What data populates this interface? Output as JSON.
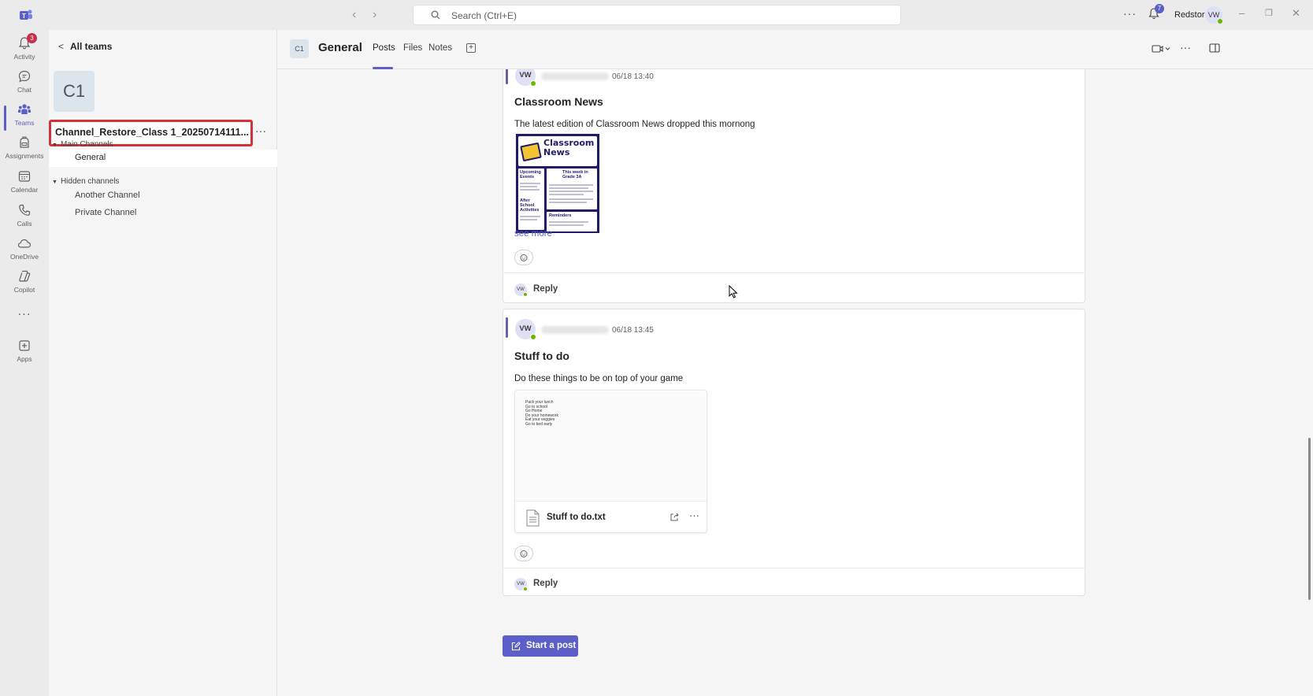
{
  "titlebar": {
    "search_placeholder": "Search (Ctrl+E)",
    "more": "···",
    "bell_badge": "7",
    "org_name": "Redstor",
    "user_initials": "VW",
    "minimize": "–",
    "restore": "❐",
    "close": "✕"
  },
  "rail": {
    "items": [
      {
        "label": "Activity",
        "icon": "bell-icon",
        "badge": "3"
      },
      {
        "label": "Chat",
        "icon": "chat-icon"
      },
      {
        "label": "Teams",
        "icon": "teams-icon"
      },
      {
        "label": "Assignments",
        "icon": "backpack-icon"
      },
      {
        "label": "Calendar",
        "icon": "calendar-icon"
      },
      {
        "label": "Calls",
        "icon": "phone-icon"
      },
      {
        "label": "OneDrive",
        "icon": "cloud-icon"
      },
      {
        "label": "Copilot",
        "icon": "copilot-icon"
      },
      {
        "label": "Apps",
        "icon": "add-app-icon"
      }
    ],
    "more": "···"
  },
  "teampanel": {
    "back_label": "All teams",
    "team_initials": "C1",
    "team_name": "Channel_Restore_Class 1_20250714111...",
    "team_more": "···",
    "sections": [
      {
        "title": "Main Channels",
        "channels": [
          "General"
        ]
      },
      {
        "title": "Hidden channels",
        "channels": [
          "Another Channel",
          "Private Channel"
        ]
      }
    ]
  },
  "channel": {
    "icon_text": "C1",
    "title": "General",
    "tabs": [
      "Posts",
      "Files",
      "Notes"
    ],
    "active_tab": "Posts",
    "add_tab": "+"
  },
  "posts": [
    {
      "initials": "VW",
      "timestamp": "06/18 13:40",
      "subject": "Classroom News",
      "body": "The latest edition of Classroom News dropped this mornong",
      "attachment": {
        "title": "Classroom News",
        "sections": [
          "Upcoming Events",
          "This week in Grade 3A",
          "After School Activities",
          "Reminders"
        ]
      },
      "see_more": "see more",
      "reply_initials": "VW",
      "reply_label": "Reply"
    },
    {
      "initials": "VW",
      "timestamp": "06/18 13:45",
      "subject": "Stuff to do",
      "body": "Do these things to be on top of your game",
      "file": {
        "name": "Stuff to do.txt",
        "preview_lines": [
          "Pack your lunch",
          "Go to school",
          "Go Home",
          "Do your homework",
          "Eat your veggies",
          "Go to bed early"
        ]
      },
      "reply_initials": "VW",
      "reply_label": "Reply"
    }
  ],
  "start_post_label": "Start a post",
  "colors": {
    "brand": "#5b5fc7",
    "highlight_border": "#d13438",
    "presence_available": "#6bb700"
  }
}
